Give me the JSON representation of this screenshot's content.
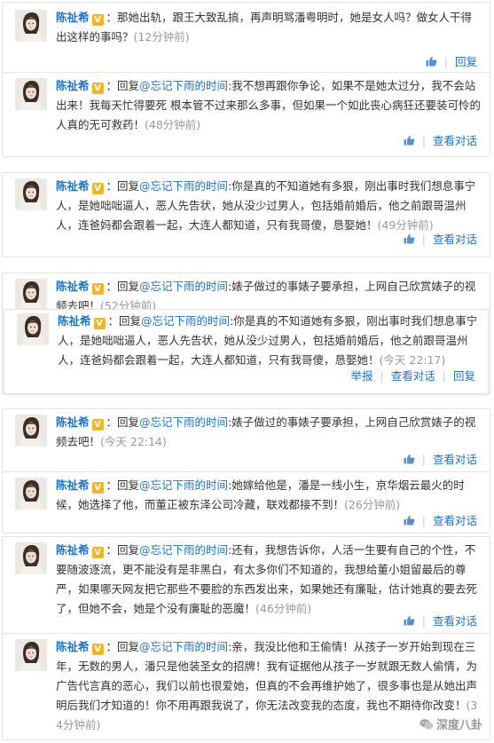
{
  "labels": {
    "username": "陈祉希",
    "verified_badge": "V",
    "reply_prefix": "回复",
    "mention": "@忘记下雨的时间",
    "reply": "回复",
    "view_conversation": "查看对话",
    "report": "举报"
  },
  "comments": [
    {
      "body": "那她出轨，跟王大致乱搞，再声明骂潘粤明时，她是女人吗？做女人干得出这样的事吗？",
      "time": "(12分钟前)"
    },
    {
      "body": "我不想再跟你争论，如果不是她太过分，我不会站出来！我每天忙得要死 根本管不过来那么多事，但如果一个如此丧心病狂还要装可怜的人真的无可救药！",
      "time": "(48分钟前)"
    },
    {
      "body": "你是真的不知道她有多狠，刚出事时我们想息事宁人，是她咄咄逼人，恶人先告状，她从没少过男人，包括婚前婚后，他之前跟哥温州人，连爸妈都会跟着一起，大连人都知道，只有我哥傻，恳娶她！",
      "time": "(49分钟前)"
    },
    {
      "body": "婊子做过的事婊子要承担，上网自己欣赏婊子的视频去吧！",
      "time": "(52分钟前)"
    },
    {
      "body": "你是真的不知道她有多狠，刚出事时我们想息事宁人，是她咄咄逼人，恶人先告状，她从没少过男人，包括婚前婚后，他之前跟哥温州人，连爸妈都会跟着一起，大连人都知道，只有我哥傻，恳娶她！",
      "time": "(今天 22:17)"
    },
    {
      "body": "婊子做过的事婊子要承担，上网自己欣赏婊子的视频去吧！",
      "time": "(今天 22:14)"
    },
    {
      "body": "她嫁给他是，潘是一线小生，京华烟云最火的时候，她选择了他，而董正被东泽公司冷藏，联戏都接不到！",
      "time": "(26分钟前)"
    },
    {
      "body": "还有，我想告诉你，人活一生要有自己的个性，不要随波逐流，更不能没有是非黑白，有太多你们不知道的，我想给董小姐留最后的尊严，如果哪天网友把它那些不要脸的东西发出来，如果她还有廉耻，估计她真的要去死了，但她不会，她是个没有廉耻的恶魔！",
      "time": "(46分钟前)"
    },
    {
      "body": "亲，我没比他和王偷情！从孩子一岁开始到现在三年，无数的男人，潘只是他装圣女的招牌！我有证据他从孩子一岁就跟无数人偷情，为广告代言真的恶心，我们以前也很爱她，但真的不会再维护她了，很多事也是从她出声明后我们才知道的！你不用再跟我说了，你无法改变我的态度，我也不期待你改变！",
      "time": "(34分钟前)"
    }
  ],
  "watermark": "深度八卦",
  "icons": [
    "thumbs-up-icon",
    "verified-v-icon",
    "avatar",
    "wechat-icon"
  ],
  "colors": {
    "name": "#1f73c4",
    "link": "#1f73c4",
    "time": "#999999",
    "badge": "#f2b42a"
  }
}
